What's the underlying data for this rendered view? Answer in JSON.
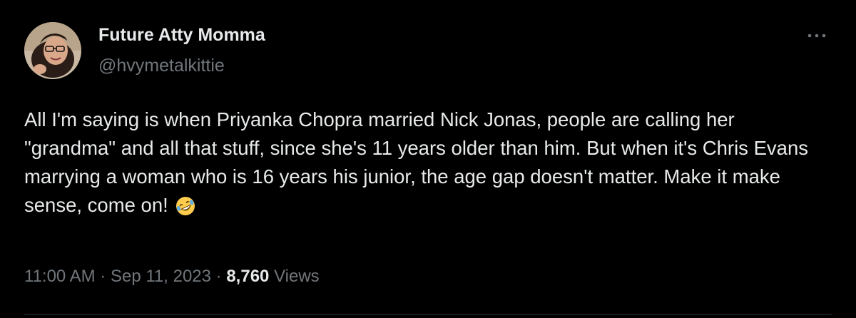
{
  "author": {
    "display_name": "Future Atty Momma",
    "handle": "@hvymetalkittie",
    "avatar": "profile-photo-icon"
  },
  "tweet": {
    "text": "All I'm saying is when Priyanka Chopra married Nick Jonas, people are calling her \"grandma\" and all that stuff, since she's 11 years older than him. But when it's Chris Evans marrying a woman who is 16 years his junior, the age gap doesn't matter. Make it make sense, come on!",
    "emoji": "rolling-on-the-floor-laughing-emoji"
  },
  "meta": {
    "time": "11:00 AM",
    "separator": "·",
    "date": "Sep 11, 2023",
    "views_count": "8,760",
    "views_label": "Views"
  },
  "icons": {
    "more": "more-options-icon"
  },
  "colors": {
    "background": "#000000",
    "primary_text": "#e7e9ea",
    "secondary_text": "#71767b",
    "divider": "#2f3336"
  }
}
